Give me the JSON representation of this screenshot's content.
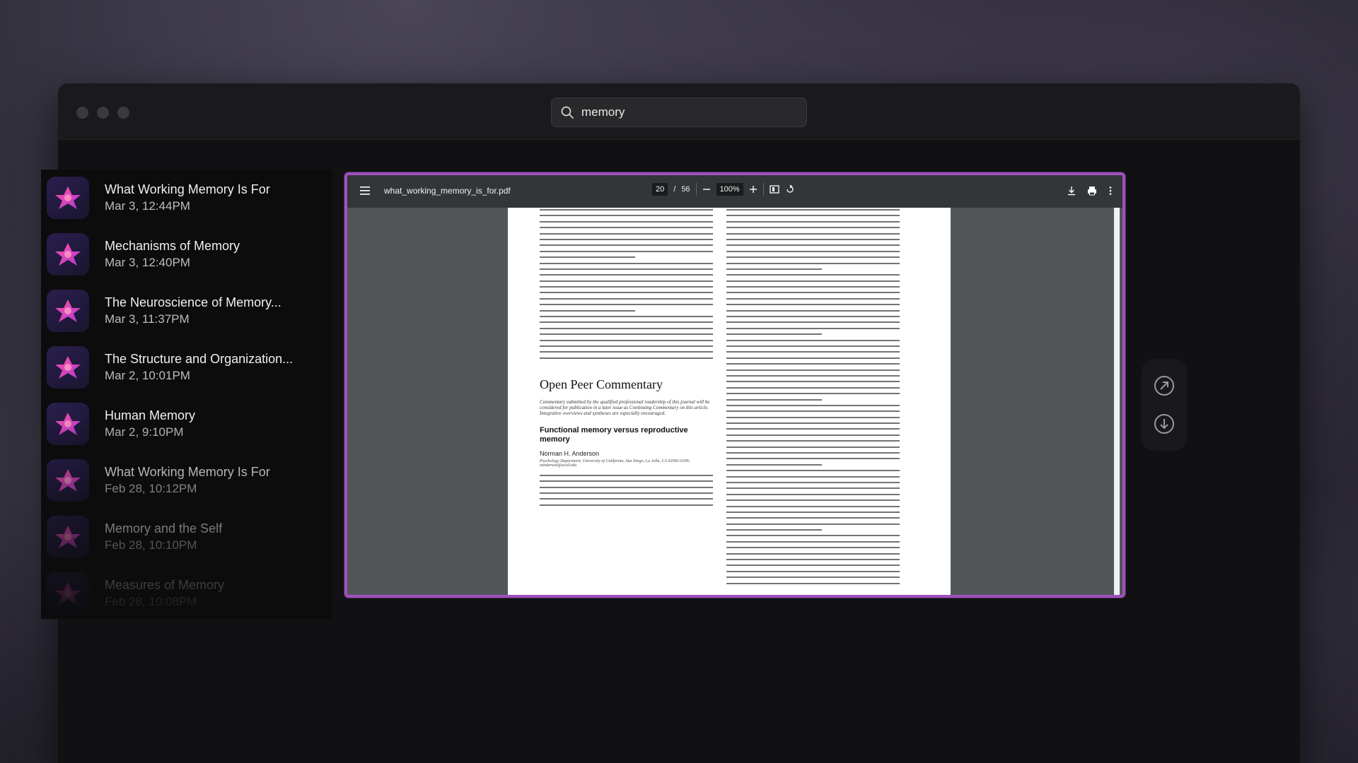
{
  "search": {
    "value": "memory",
    "placeholder": "Search"
  },
  "results": [
    {
      "title": "What Working Memory Is For",
      "date": "Mar 3, 12:44PM"
    },
    {
      "title": "Mechanisms of Memory",
      "date": "Mar 3, 12:40PM"
    },
    {
      "title": "The Neuroscience of Memory...",
      "date": "Mar 3, 11:37PM"
    },
    {
      "title": "The Structure and Organization...",
      "date": "Mar 2, 10:01PM"
    },
    {
      "title": "Human Memory",
      "date": "Mar 2, 9:10PM"
    },
    {
      "title": "What Working Memory Is For",
      "date": "Feb 28, 10:12PM"
    },
    {
      "title": "Memory and the Self",
      "date": "Feb 28, 10:10PM"
    },
    {
      "title": "Measures of Memory",
      "date": "Feb 28, 10:08PM"
    }
  ],
  "pdf": {
    "filename": "what_working_memory_is_for.pdf",
    "page_current": "20",
    "page_sep": "/",
    "page_total": "56",
    "zoom": "100%",
    "heading_open": "Open Peer Commentary",
    "italic_note": "Commentary submitted by the qualified professional readership of this journal will be considered for publication in a later issue as Continuing Commentary on this article. Integrative overviews and syntheses are especially encouraged.",
    "heading_func": "Functional memory versus reproductive memory",
    "author": "Norman H. Anderson",
    "affiliation": "Psychology Department, University of California, San Diego, La Jolla, CA 92093-0109; nanderson@ucsd.edu"
  },
  "icons": {
    "search": "search-icon",
    "menu": "menu-icon",
    "download": "download-icon",
    "print": "print-icon",
    "more": "more-vertical-icon",
    "open": "open-external-icon",
    "save": "download-circle-icon"
  },
  "colors": {
    "accent": "#a14fc0",
    "pdf_toolbar": "#323639",
    "pdf_bg": "#525659"
  }
}
